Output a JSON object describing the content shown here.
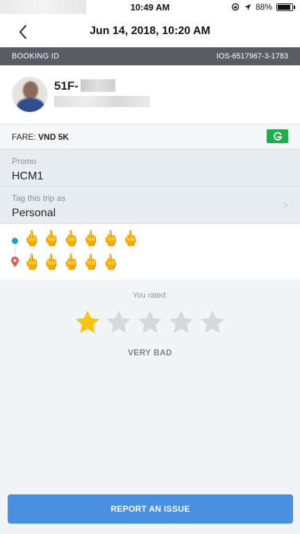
{
  "status_bar": {
    "time": "10:49 AM",
    "battery": "88%",
    "battery_level": 0.88
  },
  "nav": {
    "title": "Jun 14, 2018, 10:20 AM"
  },
  "booking": {
    "label": "BOOKING ID",
    "id": "IOS-6517967-3-1783"
  },
  "driver": {
    "plate": "51F-"
  },
  "fare": {
    "label": "FARE:",
    "value": "VND 5K",
    "payment_badge": "G"
  },
  "promo": {
    "label": "Promo",
    "value": "HCM1"
  },
  "tag": {
    "label": "Tag this trip as",
    "value": "Personal"
  },
  "route": {
    "pickup": "🖕🖕🖕🖕🖕🖕",
    "dropoff": "🖕🖕🖕🖕🖕"
  },
  "rating": {
    "label": "You rated:",
    "stars_filled": 1,
    "stars_total": 5,
    "word": "VERY BAD"
  },
  "report_button": "REPORT AN ISSUE",
  "colors": {
    "accent": "#4a90e2",
    "star_filled": "#f7c315",
    "star_empty": "#d6d9dc",
    "badge_green": "#1fae4b",
    "header_bar": "#585d66"
  }
}
